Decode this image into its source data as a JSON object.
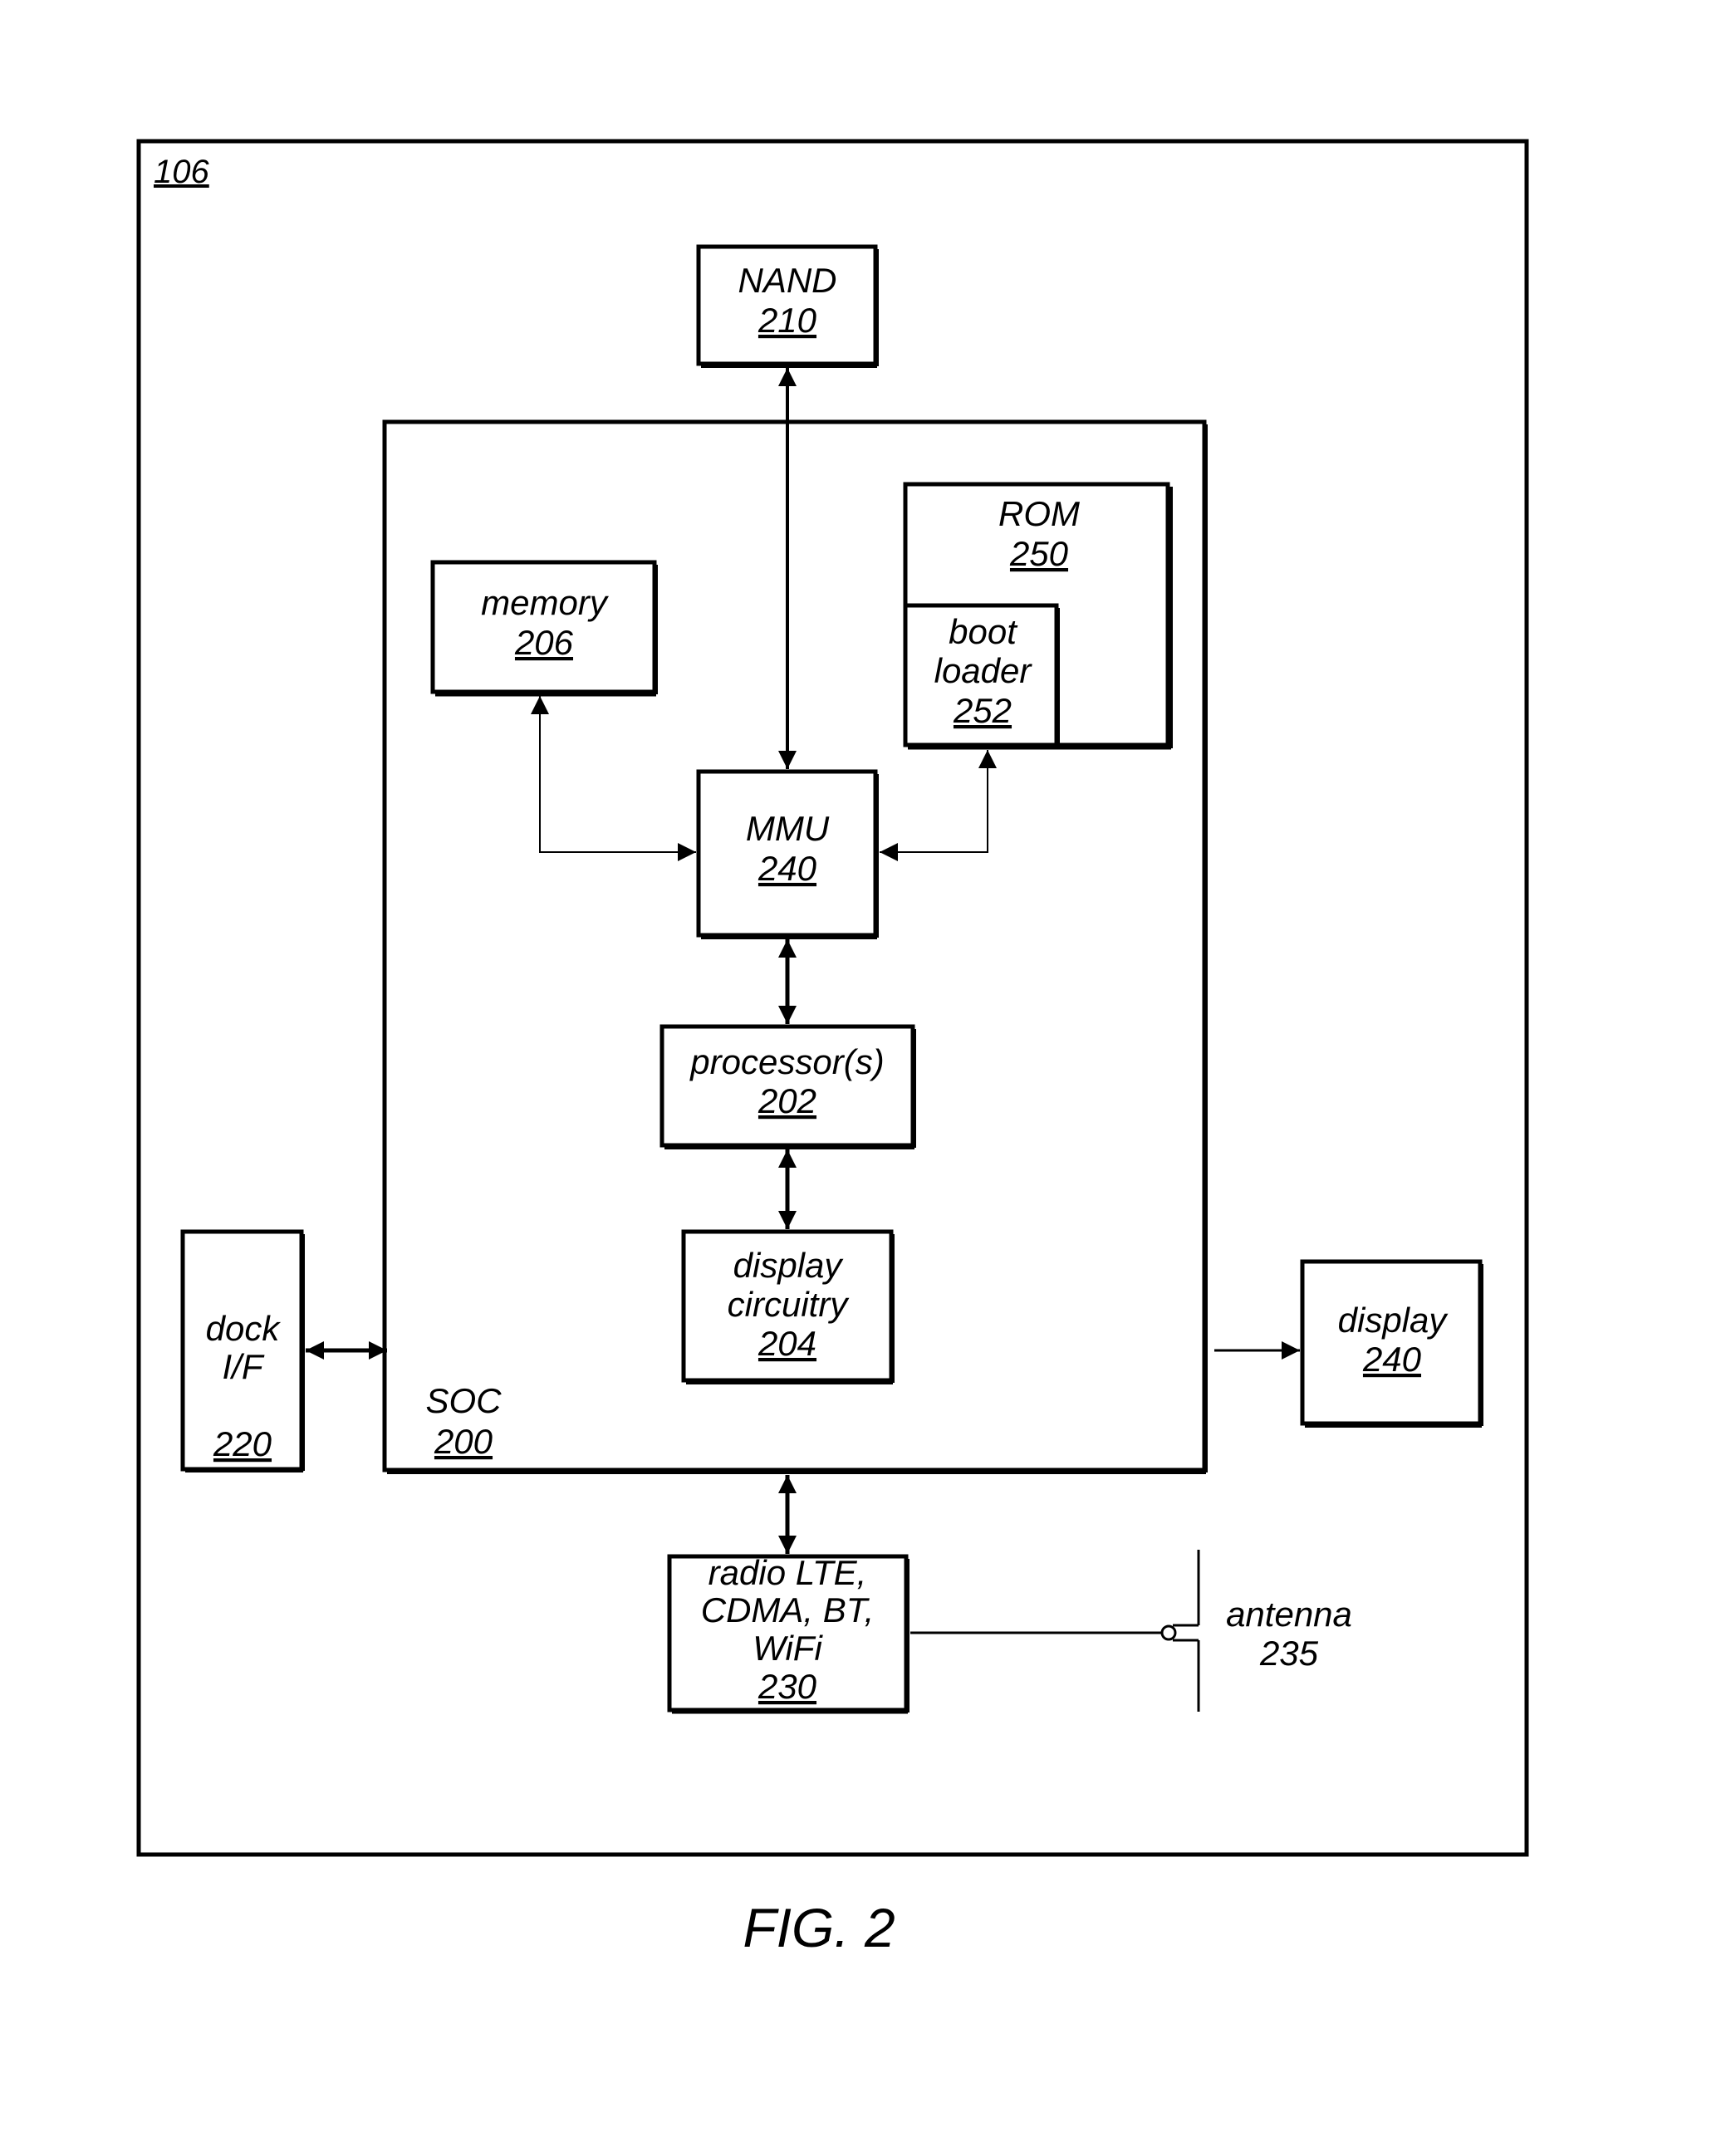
{
  "figure": {
    "caption": "FIG. 2",
    "device_ref": "106",
    "colors": {
      "stroke": "#000000",
      "background": "#ffffff"
    }
  },
  "blocks": {
    "nand": {
      "label": "NAND",
      "ref": "210"
    },
    "soc": {
      "label": "SOC",
      "ref": "200"
    },
    "memory": {
      "label": "memory",
      "ref": "206"
    },
    "rom": {
      "label": "ROM",
      "ref": "250"
    },
    "boot_loader": {
      "label_line1": "boot",
      "label_line2": "loader",
      "ref": "252"
    },
    "mmu": {
      "label": "MMU",
      "ref": "240"
    },
    "processor": {
      "label": "processor(s)",
      "ref": "202"
    },
    "display_circuitry": {
      "label_line1": "display",
      "label_line2": "circuitry",
      "ref": "204"
    },
    "dock": {
      "label_line1": "dock",
      "label_line2": "I/F",
      "ref": "220"
    },
    "display": {
      "label": "display",
      "ref": "240"
    },
    "radio": {
      "label_line1": "radio LTE,",
      "label_line2": "CDMA, BT,",
      "label_line3": "WiFi",
      "ref": "230"
    },
    "antenna": {
      "label": "antenna",
      "ref": "235"
    }
  },
  "connections": [
    {
      "from": "nand",
      "to": "mmu",
      "direction": "bidirectional"
    },
    {
      "from": "memory",
      "to": "mmu",
      "direction": "bidirectional"
    },
    {
      "from": "rom",
      "to": "mmu",
      "direction": "bidirectional"
    },
    {
      "from": "mmu",
      "to": "processor",
      "direction": "bidirectional"
    },
    {
      "from": "processor",
      "to": "display_circuitry",
      "direction": "bidirectional"
    },
    {
      "from": "dock",
      "to": "soc",
      "direction": "bidirectional"
    },
    {
      "from": "soc",
      "to": "display",
      "direction": "forward"
    },
    {
      "from": "soc",
      "to": "radio",
      "direction": "bidirectional"
    },
    {
      "from": "radio",
      "to": "antenna",
      "direction": "none"
    }
  ]
}
